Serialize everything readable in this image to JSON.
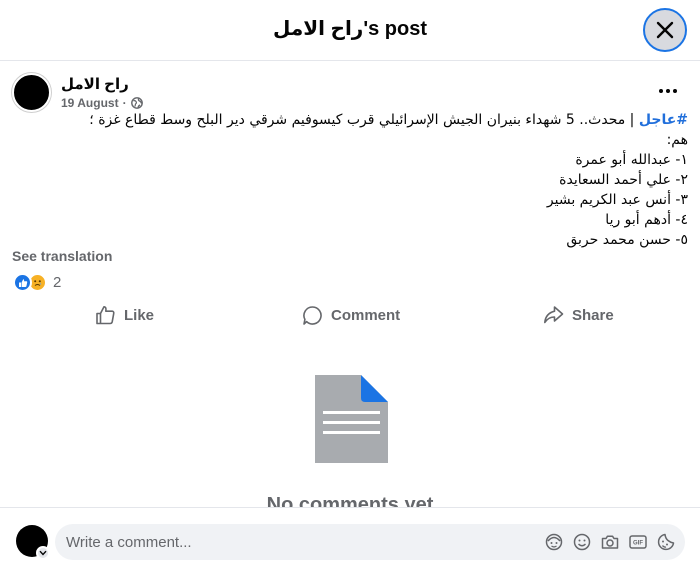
{
  "header": {
    "title": "راح الامل's post"
  },
  "post": {
    "author": "راح الامل",
    "date": "19 August",
    "separator": "·",
    "hashtag": "#عاجل",
    "intro": " | محدث.. 5 شهداء بنيران الجيش الإسرائيلي قرب كيسوفيم شرقي دير البلح وسط قطاع غزة ؛ هم:",
    "names": [
      "١- عبدالله أبو عمرة",
      "٢- علي أحمد السعايدة",
      "٣-  أنس عبد الكريم بشير",
      "٤-  أدهم أبو ريا",
      "٥- حسن محمد حربق"
    ],
    "see_translation": "See translation",
    "reaction_count": "2"
  },
  "actions": {
    "like": "Like",
    "comment": "Comment",
    "share": "Share"
  },
  "comments": {
    "empty_text": "No comments yet"
  },
  "composer": {
    "placeholder": "Write a comment..."
  },
  "icons": {
    "close": "close-icon",
    "more": "more-icon",
    "globe": "globe-icon",
    "like": "like-icon",
    "comment": "comment-icon",
    "share": "share-icon",
    "avatar_sticker": "avatar-sticker-icon",
    "emoji": "emoji-icon",
    "camera": "camera-icon",
    "gif": "gif-icon",
    "sticker": "sticker-icon"
  },
  "colors": {
    "accent": "#1b74e4",
    "hashtag": "#216fdb",
    "secondary_text": "#65676b",
    "input_bg": "#f0f2f5",
    "doc_gray": "#a8abaf"
  }
}
